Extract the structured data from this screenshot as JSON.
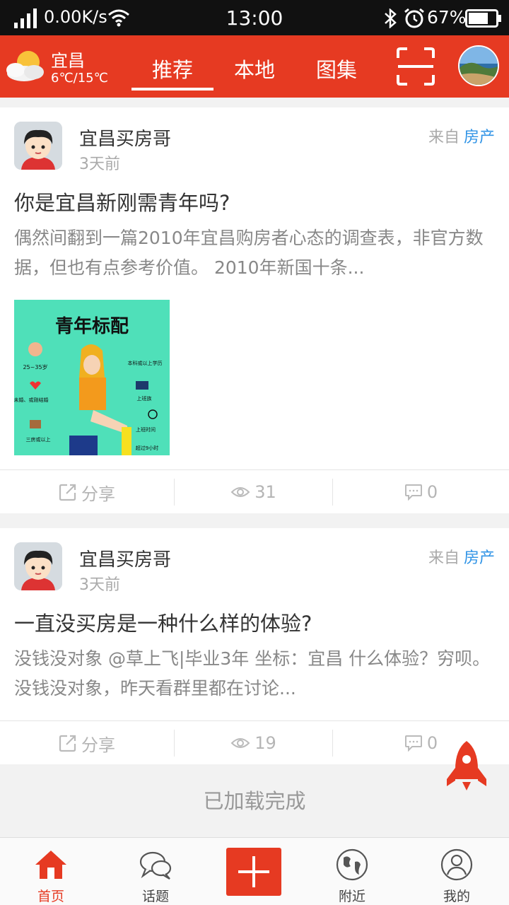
{
  "status_bar": {
    "speed": "0.00K/s",
    "time": "13:00",
    "battery": "67%"
  },
  "header": {
    "city": "宜昌",
    "temperature": "6℃/15℃",
    "tabs": [
      {
        "label": "推荐",
        "active": true
      },
      {
        "label": "本地",
        "active": false
      },
      {
        "label": "图集",
        "active": false
      }
    ],
    "accent_color": "#e63a22"
  },
  "posts": [
    {
      "author": "宜昌买房哥",
      "time": "3天前",
      "from_prefix": "来自",
      "category": "房产",
      "title": "你是宜昌新刚需青年吗?",
      "excerpt": "偶然间翻到一篇2010年宜昌购房者心态的调查表，非官方数据，但也有点参考价值。 2010年新国十条...",
      "image_caption": "青年标配",
      "image_labels": [
        "25~35岁",
        "本科或以上学历",
        "未婚、或刚结婚",
        "上班族",
        "三房或以上",
        "上班时间",
        "超过9小时"
      ],
      "share_label": "分享",
      "views": "31",
      "comments": "0"
    },
    {
      "author": "宜昌买房哥",
      "time": "3天前",
      "from_prefix": "来自",
      "category": "房产",
      "title": "一直没买房是一种什么样的体验?",
      "excerpt": "没钱没对象 @草上飞|毕业3年 坐标：宜昌 什么体验？穷呗。没钱没对象，昨天看群里都在讨论...",
      "share_label": "分享",
      "views": "19",
      "comments": "0"
    }
  ],
  "loaded_text": "已加载完成",
  "bottom_nav": [
    {
      "label": "首页",
      "icon": "home-icon",
      "active": true
    },
    {
      "label": "话题",
      "icon": "chat-bubbles-icon",
      "active": false
    },
    {
      "label": "",
      "icon": "plus-icon",
      "active": false
    },
    {
      "label": "附近",
      "icon": "globe-icon",
      "active": false
    },
    {
      "label": "我的",
      "icon": "user-icon",
      "active": false
    }
  ]
}
